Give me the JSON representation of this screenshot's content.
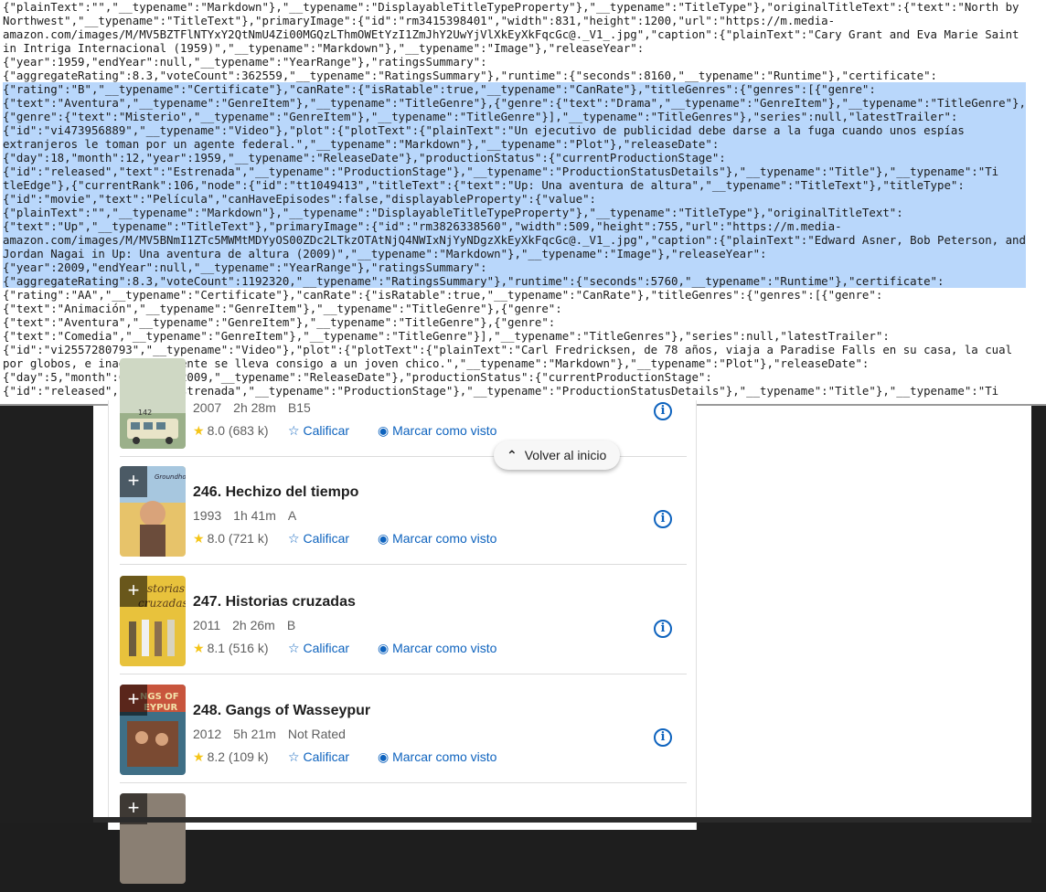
{
  "json_viewer": {
    "lines": [
      {
        "text": "{\"plainText\":\"\",\"__typename\":\"Markdown\"},\"__typename\":\"DisplayableTitleTypeProperty\"},\"__typename\":\"TitleType\"},\"originalTitleText\":{\"text\":\"North by",
        "selected": false
      },
      {
        "text": "Northwest\",\"__typename\":\"TitleText\"},\"primaryImage\":{\"id\":\"rm3415398401\",\"width\":831,\"height\":1200,\"url\":\"https://m.media-",
        "selected": false
      },
      {
        "text": "amazon.com/images/M/MV5BZTFlNTYxY2QtNmU4Zi00MGQzLThmOWEtYzI1ZmJhY2UwYjVlXkEyXkFqcGc@._V1_.jpg\",\"caption\":{\"plainText\":\"Cary Grant and Eva Marie Saint",
        "selected": false
      },
      {
        "text": "in Intriga Internacional (1959)\",\"__typename\":\"Markdown\"},\"__typename\":\"Image\"},\"releaseYear\":",
        "selected": false
      },
      {
        "text": "{\"year\":1959,\"endYear\":null,\"__typename\":\"YearRange\"},\"ratingsSummary\":",
        "selected": false
      },
      {
        "text": "{\"aggregateRating\":8.3,\"voteCount\":362559,\"__typename\":\"RatingsSummary\"},\"runtime\":{\"seconds\":8160,\"__typename\":\"Runtime\"},\"certificate\":",
        "selected": false
      },
      {
        "text": "{\"rating\":\"B\",\"__typename\":\"Certificate\"},\"canRate\":{\"isRatable\":true,\"__typename\":\"CanRate\"},\"titleGenres\":{\"genres\":[{\"genre\":",
        "selected": true
      },
      {
        "text": "{\"text\":\"Aventura\",\"__typename\":\"GenreItem\"},\"__typename\":\"TitleGenre\"},{\"genre\":{\"text\":\"Drama\",\"__typename\":\"GenreItem\"},\"__typename\":\"TitleGenre\"},",
        "selected": true
      },
      {
        "text": "{\"genre\":{\"text\":\"Misterio\",\"__typename\":\"GenreItem\"},\"__typename\":\"TitleGenre\"}],\"__typename\":\"TitleGenres\"},\"series\":null,\"latestTrailer\":",
        "selected": true
      },
      {
        "text": "{\"id\":\"vi473956889\",\"__typename\":\"Video\"},\"plot\":{\"plotText\":{\"plainText\":\"Un ejecutivo de publicidad debe darse a la fuga cuando unos espías",
        "selected": true
      },
      {
        "text": "extranjeros le toman por un agente federal.\",\"__typename\":\"Markdown\"},\"__typename\":\"Plot\"},\"releaseDate\":",
        "selected": true
      },
      {
        "text": "{\"day\":18,\"month\":12,\"year\":1959,\"__typename\":\"ReleaseDate\"},\"productionStatus\":{\"currentProductionStage\":",
        "selected": true
      },
      {
        "text": "{\"id\":\"released\",\"text\":\"Estrenada\",\"__typename\":\"ProductionStage\"},\"__typename\":\"ProductionStatusDetails\"},\"__typename\":\"Title\"},\"__typename\":\"Ti",
        "selected": true
      },
      {
        "text": "tleEdge\"},{\"currentRank\":106,\"node\":{\"id\":\"tt1049413\",\"titleText\":{\"text\":\"Up: Una aventura de altura\",\"__typename\":\"TitleText\"},\"titleType\":",
        "selected": true
      },
      {
        "text": "{\"id\":\"movie\",\"text\":\"Película\",\"canHaveEpisodes\":false,\"displayableProperty\":{\"value\":",
        "selected": true
      },
      {
        "text": "{\"plainText\":\"\",\"__typename\":\"Markdown\"},\"__typename\":\"DisplayableTitleTypeProperty\"},\"__typename\":\"TitleType\"},\"originalTitleText\":",
        "selected": true
      },
      {
        "text": "{\"text\":\"Up\",\"__typename\":\"TitleText\"},\"primaryImage\":{\"id\":\"rm3826338560\",\"width\":509,\"height\":755,\"url\":\"https://m.media-",
        "selected": true
      },
      {
        "text": "amazon.com/images/M/MV5BNmI1ZTc5MWMtMDYyOS00ZDc2LTkzOTAtNjQ4NWIxNjYyNDgzXkEyXkFqcGc@._V1_.jpg\",\"caption\":{\"plainText\":\"Edward Asner, Bob Peterson, and",
        "selected": true
      },
      {
        "text": "Jordan Nagai in Up: Una aventura de altura (2009)\",\"__typename\":\"Markdown\"},\"__typename\":\"Image\"},\"releaseYear\":",
        "selected": true
      },
      {
        "text": "{\"year\":2009,\"endYear\":null,\"__typename\":\"YearRange\"},\"ratingsSummary\":",
        "selected": true
      },
      {
        "text": "{\"aggregateRating\":8.3,\"voteCount\":1192320,\"__typename\":\"RatingsSummary\"},\"runtime\":{\"seconds\":5760,\"__typename\":\"Runtime\"},\"certificate\":",
        "selected": true
      },
      {
        "text": "{\"rating\":\"AA\",\"__typename\":\"Certificate\"},\"canRate\":{\"isRatable\":true,\"__typename\":\"CanRate\"},\"titleGenres\":{\"genres\":[{\"genre\":",
        "selected": false
      },
      {
        "text": "{\"text\":\"Animación\",\"__typename\":\"GenreItem\"},\"__typename\":\"TitleGenre\"},{\"genre\":",
        "selected": false
      },
      {
        "text": "{\"text\":\"Aventura\",\"__typename\":\"GenreItem\"},\"__typename\":\"TitleGenre\"},{\"genre\":",
        "selected": false
      },
      {
        "text": "{\"text\":\"Comedia\",\"__typename\":\"GenreItem\"},\"__typename\":\"TitleGenre\"}],\"__typename\":\"TitleGenres\"},\"series\":null,\"latestTrailer\":",
        "selected": false
      },
      {
        "text": "{\"id\":\"vi2557280793\",\"__typename\":\"Video\"},\"plot\":{\"plotText\":{\"plainText\":\"Carl Fredricksen, de 78 años, viaja a Paradise Falls en su casa, la cual",
        "selected": false
      },
      {
        "text": "por globos, e inadvertidamente se lleva consigo a un joven chico.\",\"__typename\":\"Markdown\"},\"__typename\":\"Plot\"},\"releaseDate\":",
        "selected": false
      },
      {
        "text": "{\"day\":5,\"month\":6,\"year\":2009,\"__typename\":\"ReleaseDate\"},\"productionStatus\":{\"currentProductionStage\":",
        "selected": false
      },
      {
        "text": "{\"id\":\"released\",\"text\":\"Estrenada\",\"__typename\":\"ProductionStage\"},\"__typename\":\"ProductionStatusDetails\"},\"__typename\":\"Title\"},\"__typename\":\"Ti",
        "selected": false
      }
    ]
  },
  "back_to_top": {
    "label": "Volver al inicio"
  },
  "movies": [
    {
      "title": "",
      "year": "2007",
      "runtime": "2h 28m",
      "certificate": "B15",
      "rating": "8.0",
      "votes": "(683 k)",
      "rate_label": "Calificar",
      "watch_label": "Marcar como visto"
    },
    {
      "title": "246. Hechizo del tiempo",
      "year": "1993",
      "runtime": "1h 41m",
      "certificate": "A",
      "rating": "8.0",
      "votes": "(721 k)",
      "rate_label": "Calificar",
      "watch_label": "Marcar como visto"
    },
    {
      "title": "247. Historias cruzadas",
      "year": "2011",
      "runtime": "2h 26m",
      "certificate": "B",
      "rating": "8.1",
      "votes": "(516 k)",
      "rate_label": "Calificar",
      "watch_label": "Marcar como visto"
    },
    {
      "title": "248. Gangs of Wasseypur",
      "year": "2012",
      "runtime": "5h 21m",
      "certificate": "Not Rated",
      "rating": "8.2",
      "votes": "(109 k)",
      "rate_label": "Calificar",
      "watch_label": "Marcar como visto"
    }
  ],
  "icons": {
    "star": "star-icon",
    "rate": "star-outline-icon",
    "watch": "eye-icon",
    "info": "info-icon",
    "add": "plus-icon",
    "chevron": "chevron-up-icon"
  },
  "colors": {
    "link": "#0e63be",
    "star": "#f5c518",
    "selection": "#b9d7fb"
  }
}
